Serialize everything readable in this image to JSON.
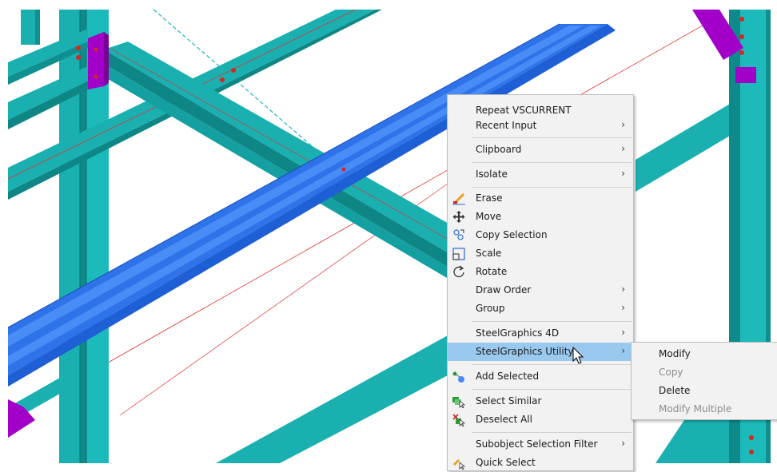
{
  "context_menu": {
    "items": [
      {
        "label": "Repeat VSCURRENT"
      },
      {
        "label": "Recent Input",
        "submenu": true
      },
      {
        "label": "Clipboard",
        "submenu": true
      },
      {
        "label": "Isolate",
        "submenu": true
      },
      {
        "label": "Erase",
        "icon": "erase-icon"
      },
      {
        "label": "Move",
        "icon": "move-icon"
      },
      {
        "label": "Copy Selection",
        "icon": "copy-selection-icon"
      },
      {
        "label": "Scale",
        "icon": "scale-icon"
      },
      {
        "label": "Rotate",
        "icon": "rotate-icon"
      },
      {
        "label": "Draw Order",
        "submenu": true
      },
      {
        "label": "Group",
        "submenu": true
      },
      {
        "label": "SteelGraphics 4D",
        "submenu": true
      },
      {
        "label": "SteelGraphics Utility",
        "submenu": true,
        "highlighted": true
      },
      {
        "label": "Add Selected",
        "icon": "add-selected-icon"
      },
      {
        "label": "Select Similar",
        "icon": "select-similar-icon"
      },
      {
        "label": "Deselect All",
        "icon": "deselect-all-icon"
      },
      {
        "label": "Subobject Selection Filter",
        "submenu": true
      },
      {
        "label": "Quick Select",
        "icon": "quick-select-icon"
      }
    ]
  },
  "submenu": {
    "items": [
      {
        "label": "Modify",
        "enabled": true
      },
      {
        "label": "Copy",
        "enabled": false
      },
      {
        "label": "Delete",
        "enabled": true
      },
      {
        "label": "Modify Multiple",
        "enabled": false
      }
    ]
  },
  "colors": {
    "beam_teal": "#17b2b2",
    "beam_selected": "#2f73ea",
    "plate_magenta": "#a200c8",
    "menu_highlight": "#99c9ef",
    "menu_background": "#f2f2f2"
  },
  "symbols": {
    "submenu_arrow": "›"
  }
}
